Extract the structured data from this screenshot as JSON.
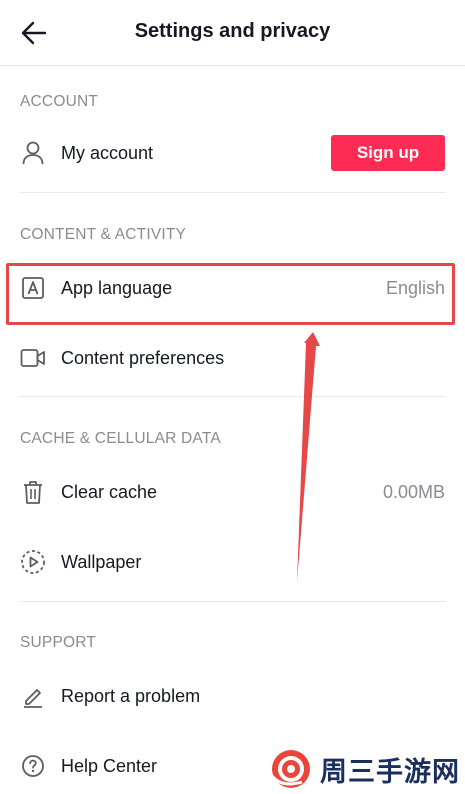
{
  "header": {
    "title": "Settings and privacy"
  },
  "sections": {
    "account": {
      "label": "ACCOUNT",
      "my_account": "My account",
      "signup_label": "Sign up"
    },
    "content": {
      "label": "CONTENT & ACTIVITY",
      "app_language": "App language",
      "app_language_value": "English",
      "content_preferences": "Content preferences"
    },
    "cache": {
      "label": "CACHE & CELLULAR DATA",
      "clear_cache": "Clear cache",
      "clear_cache_value": "0.00MB",
      "wallpaper": "Wallpaper"
    },
    "support": {
      "label": "SUPPORT",
      "report_problem": "Report a problem",
      "help_center": "Help Center"
    }
  },
  "icons": {
    "back": "back-arrow-icon",
    "user": "user-icon",
    "language": "language-icon",
    "video": "video-camera-icon",
    "trash": "trash-icon",
    "wallpaper": "wallpaper-icon",
    "pencil": "pencil-icon",
    "help": "help-circle-icon"
  },
  "colors": {
    "accent": "#fe2c55",
    "annotation": "#e64747",
    "muted_text": "#8a8b91"
  },
  "watermark": {
    "text": "周三手游网"
  }
}
